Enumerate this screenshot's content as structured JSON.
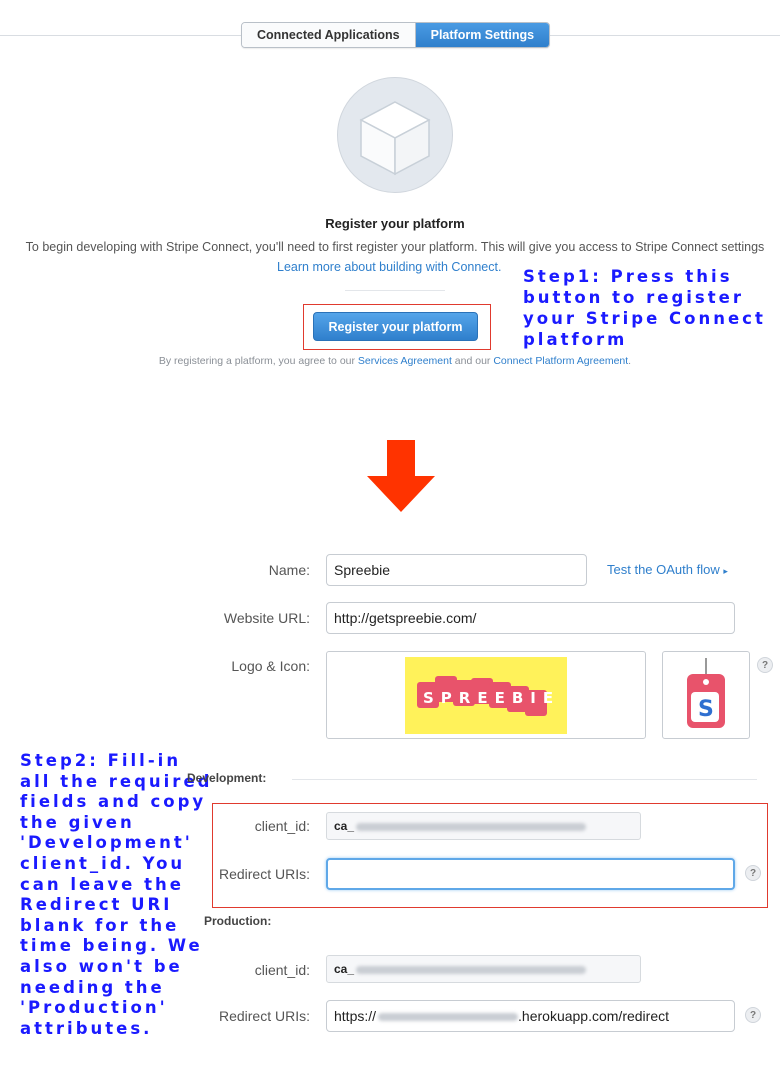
{
  "tabs": {
    "connected_applications": "Connected Applications",
    "platform_settings": "Platform Settings"
  },
  "register": {
    "title": "Register your platform",
    "description": "To begin developing with Stripe Connect, you'll need to first register your platform. This will give you access to Stripe Connect settings",
    "learn_more_link": "Learn more about building with Connect.",
    "button_label": "Register your platform",
    "agreement_prefix": "By registering a platform, you agree to our ",
    "services_agreement": "Services Agreement",
    "agreement_middle": " and our ",
    "connect_platform_agreement": "Connect Platform Agreement",
    "agreement_suffix": "."
  },
  "annotations": {
    "step1": "Step1: Press this button to register your Stripe Connect platform",
    "step2": "Step2: Fill-in all the required fields and copy the given 'Development' client_id. You can leave the Redirect URI blank for the time being. We also won't be needing the 'Production' attributes."
  },
  "form": {
    "name_label": "Name:",
    "name_value": "Spreebie",
    "oauth_link": "Test the OAuth flow",
    "website_label": "Website URL:",
    "website_value": "http://getspreebie.com/",
    "logo_label": "Logo & Icon:",
    "logo_text": "SPREEBIE",
    "icon_text": "S",
    "help": "?"
  },
  "development": {
    "title": "Development:",
    "client_id_label": "client_id:",
    "client_id_prefix": "ca_",
    "redirect_label": "Redirect URIs:",
    "redirect_value": ""
  },
  "production": {
    "title": "Production:",
    "client_id_label": "client_id:",
    "client_id_prefix": "ca_",
    "redirect_label": "Redirect URIs:",
    "redirect_prefix": "https://",
    "redirect_suffix": ".herokuapp.com/redirect"
  },
  "colors": {
    "accent_blue": "#2f7fcc",
    "annotation_blue": "#1a1aff",
    "highlight_red": "#e03a2e",
    "arrow_red": "#ff3300",
    "logo_yellow": "#fff25a",
    "tag_pink": "#e8536b"
  }
}
